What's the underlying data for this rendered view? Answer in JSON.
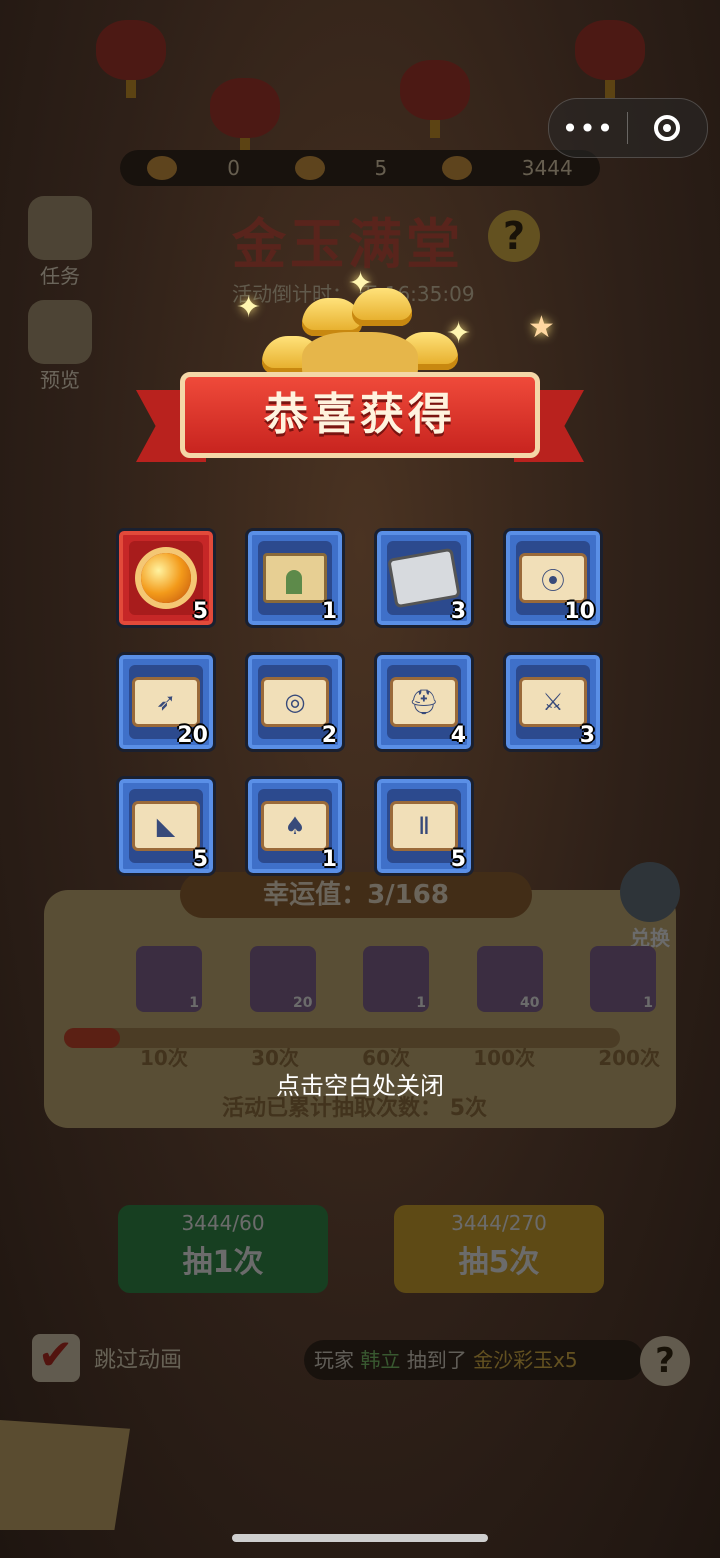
{
  "capsule": {
    "more_icon": "more-dots-icon",
    "close_icon": "target-icon"
  },
  "background": {
    "resources": [
      {
        "icon": "scroll-token-icon",
        "value": "0"
      },
      {
        "icon": "mask-token-icon",
        "value": "5"
      },
      {
        "icon": "gold-ingot-icon",
        "value": "3444"
      }
    ],
    "event_title": "金玉满堂",
    "countdown_text": "活动倒计时：   天 16:35:09",
    "side_buttons": [
      {
        "label": "任务",
        "icon": "task-icon"
      },
      {
        "label": "预览",
        "icon": "preview-icon"
      }
    ],
    "luck_text": "幸运值：3/168",
    "exchange_label": "兑换",
    "milestones": [
      {
        "qty": "1"
      },
      {
        "qty": "20"
      },
      {
        "qty": "1"
      },
      {
        "qty": "40"
      },
      {
        "qty": "1"
      }
    ],
    "progress_fraction": 0.1,
    "milestone_ticks": [
      "10次",
      "30次",
      "60次",
      "100次",
      "200次"
    ],
    "total_draws_label": "活动已累计抽取次数：",
    "total_draws_value": "5次",
    "draw_buttons": [
      {
        "cost": "3444/60",
        "label": "抽1次",
        "color": "#2f9a4a"
      },
      {
        "cost": "3444/270",
        "label": "抽5次",
        "color": "#e5b025"
      }
    ],
    "skip_label": "跳过动画",
    "ticker": {
      "prefix": "玩家",
      "player": "韩立",
      "verb": "抽到了",
      "item": "金沙彩玉x5"
    }
  },
  "popup": {
    "title": "恭喜获得",
    "close_hint": "点击空白处关闭",
    "rewards": [
      {
        "icon": "orange-orb-icon",
        "kind": "orb",
        "frame": "red",
        "qty": "5"
      },
      {
        "icon": "gate-scroll-icon",
        "kind": "gate",
        "frame": "blue",
        "qty": "1"
      },
      {
        "icon": "stone-icon",
        "kind": "stone",
        "frame": "blue",
        "qty": "3"
      },
      {
        "icon": "red-scroll-icon",
        "kind": "scroll",
        "glyph": "⦿",
        "frame": "blue",
        "qty": "10"
      },
      {
        "icon": "bow-scroll-icon",
        "kind": "scroll",
        "glyph": "➶",
        "frame": "blue",
        "qty": "20"
      },
      {
        "icon": "ring-scroll-icon",
        "kind": "scroll",
        "glyph": "◎",
        "frame": "blue",
        "qty": "2"
      },
      {
        "icon": "helmet-scroll-icon",
        "kind": "scroll",
        "glyph": "⛑",
        "frame": "blue",
        "qty": "4"
      },
      {
        "icon": "sword-scroll-icon",
        "kind": "scroll",
        "glyph": "⚔",
        "frame": "blue",
        "qty": "3"
      },
      {
        "icon": "boots-scroll-icon",
        "kind": "scroll",
        "glyph": "◣",
        "frame": "blue",
        "qty": "5"
      },
      {
        "icon": "armor-scroll-icon",
        "kind": "scroll",
        "glyph": "♠",
        "frame": "blue",
        "qty": "1"
      },
      {
        "icon": "pants-scroll-icon",
        "kind": "scroll",
        "glyph": "Ⅱ",
        "frame": "blue",
        "qty": "5"
      }
    ]
  }
}
